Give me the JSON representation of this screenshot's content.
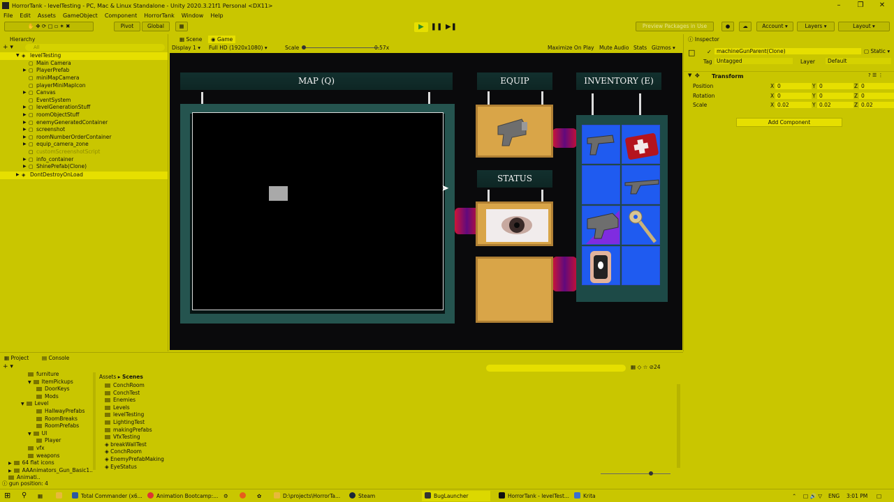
{
  "window": {
    "title": "HorrorTank - levelTesting - PC, Mac & Linux Standalone - Unity 2020.3.21f1 Personal <DX11>"
  },
  "menu": [
    "File",
    "Edit",
    "Assets",
    "GameObject",
    "Component",
    "HorrorTank",
    "Window",
    "Help"
  ],
  "toolbar": {
    "pivot": "Pivot",
    "global": "Global",
    "preview": "Preview Packages in Use",
    "account": "Account",
    "layers": "Layers",
    "layout": "Layout"
  },
  "hierarchy": {
    "tab": "Hierarchy",
    "search_placeholder": "All",
    "scene": "levelTesting",
    "items": [
      "Main Camera",
      "PlayerPrefab",
      "miniMapCamera",
      "playerMiniMapIcon",
      "Canvas",
      "EventSystem",
      "levelGenerationStuff",
      "roomObjectStuff",
      "enemyGeneratedContainer",
      "screenshot",
      "roomNumberOrderContainer",
      "equip_camera_zone",
      "customScreenshotScript",
      "info_container",
      "ShinePrefab(Clone)"
    ],
    "dontdestroy": "DontDestroyOnLoad"
  },
  "game": {
    "tab_scene": "Scene",
    "tab_game": "Game",
    "display": "Display 1",
    "resolution": "Full HD (1920x1080)",
    "scale_label": "Scale",
    "scale_value": "0.57x",
    "maximize": "Maximize On Play",
    "mute": "Mute Audio",
    "stats": "Stats",
    "gizmos": "Gizmos",
    "map_title": "MAP (Q)",
    "equip_title": "EQUIP",
    "status_title": "STATUS",
    "inventory_title": "INVENTORY (E)"
  },
  "inspector": {
    "tab": "Inspector",
    "object_name": "machineGunParent(Clone)",
    "static_label": "Static",
    "tag_label": "Tag",
    "tag_value": "Untagged",
    "layer_label": "Layer",
    "layer_value": "Default",
    "component": "Transform",
    "position": {
      "label": "Position",
      "x": "0",
      "y": "0",
      "z": "0"
    },
    "rotation": {
      "label": "Rotation",
      "x": "0",
      "y": "0",
      "z": "0"
    },
    "scale": {
      "label": "Scale",
      "x": "0.02",
      "y": "0.02",
      "z": "0.02"
    },
    "add_component": "Add Component"
  },
  "project": {
    "tab_project": "Project",
    "tab_console": "Console",
    "breadcrumb_root": "Assets",
    "breadcrumb_current": "Scenes",
    "hidden_count": "24",
    "tree": [
      "furniture",
      "ItemPickups",
      "DoorKeys",
      "Mods",
      "Level",
      "HallwayPrefabs",
      "RoomBreaks",
      "RoomPrefabs",
      "UI",
      "Player",
      "vfx",
      "weapons",
      "64 flat icons",
      "AAAnimators_Gun_Basic1..",
      "Animati.."
    ],
    "files": [
      "ConchRoom",
      "ConchTest",
      "Enemies",
      "Levels",
      "levelTesting",
      "LightingTest",
      "makingPrefabs",
      "VfxTesting",
      "breakWallTest",
      "ConchRoom",
      "EnemyPrefabMaking",
      "EyeStatus"
    ]
  },
  "status_bar": {
    "text": "gun position: 4"
  },
  "taskbar": {
    "apps": [
      "Total Commander (x6...",
      "Animation Bootcamp:...",
      "D:\\projects\\HorrorTa...",
      "Steam",
      "BugLauncher",
      "HorrorTank - levelTest...",
      "Krita"
    ],
    "lang": "ENG",
    "clock": "3:01 PM"
  },
  "colors": {
    "chrome": "#c9c600",
    "selection": "#e6df00",
    "inventory_cell": "#1f5bf0"
  }
}
